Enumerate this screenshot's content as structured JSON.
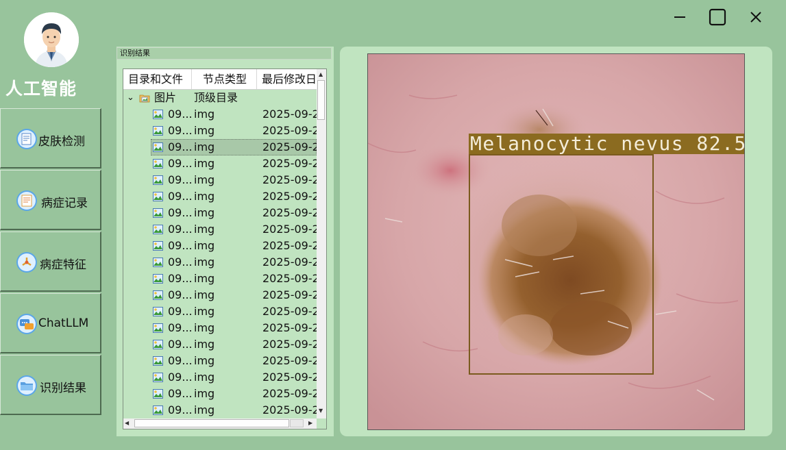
{
  "app": {
    "title": "人工智能"
  },
  "window_controls": {
    "minimize": "minimize-icon",
    "maximize": "maximize-icon",
    "close": "close-icon"
  },
  "sidebar": {
    "items": [
      {
        "label": "皮肤检测",
        "icon": "document-icon"
      },
      {
        "label": "病症记录",
        "icon": "notes-icon"
      },
      {
        "label": "病症特征",
        "icon": "features-icon"
      },
      {
        "label": "ChatLLM",
        "icon": "chat-icon"
      },
      {
        "label": "识别结果",
        "icon": "folder-icon"
      }
    ]
  },
  "results_panel": {
    "title": "识别结果",
    "columns": [
      "目录和文件",
      "节点类型",
      "最后修改日"
    ],
    "root": {
      "name": "图片",
      "type": "顶级目录",
      "expand_glyph": "⌄"
    },
    "rows": [
      {
        "name": "09...",
        "type": "img",
        "date": "2025-09-2"
      },
      {
        "name": "09...",
        "type": "img",
        "date": "2025-09-2"
      },
      {
        "name": "09...",
        "type": "img",
        "date": "2025-09-2",
        "selected": true
      },
      {
        "name": "09...",
        "type": "img",
        "date": "2025-09-2"
      },
      {
        "name": "09...",
        "type": "img",
        "date": "2025-09-2"
      },
      {
        "name": "09...",
        "type": "img",
        "date": "2025-09-2"
      },
      {
        "name": "09...",
        "type": "img",
        "date": "2025-09-2"
      },
      {
        "name": "09...",
        "type": "img",
        "date": "2025-09-2"
      },
      {
        "name": "09...",
        "type": "img",
        "date": "2025-09-2"
      },
      {
        "name": "09...",
        "type": "img",
        "date": "2025-09-2"
      },
      {
        "name": "09...",
        "type": "img",
        "date": "2025-09-2"
      },
      {
        "name": "09...",
        "type": "img",
        "date": "2025-09-2"
      },
      {
        "name": "09...",
        "type": "img",
        "date": "2025-09-2"
      },
      {
        "name": "09...",
        "type": "img",
        "date": "2025-09-2"
      },
      {
        "name": "09...",
        "type": "img",
        "date": "2025-09-2"
      },
      {
        "name": "09...",
        "type": "img",
        "date": "2025-09-2"
      },
      {
        "name": "09...",
        "type": "img",
        "date": "2025-09-2"
      },
      {
        "name": "09...",
        "type": "img",
        "date": "2025-09-2"
      },
      {
        "name": "09...",
        "type": "img",
        "date": "2025-09-2"
      }
    ]
  },
  "detection": {
    "label": "Melanocytic nevus 82.5",
    "color": "#8b6b20"
  },
  "colors": {
    "background": "#98c49c",
    "panel": "#c0e4c0",
    "selected_row": "#a8c8a8"
  }
}
